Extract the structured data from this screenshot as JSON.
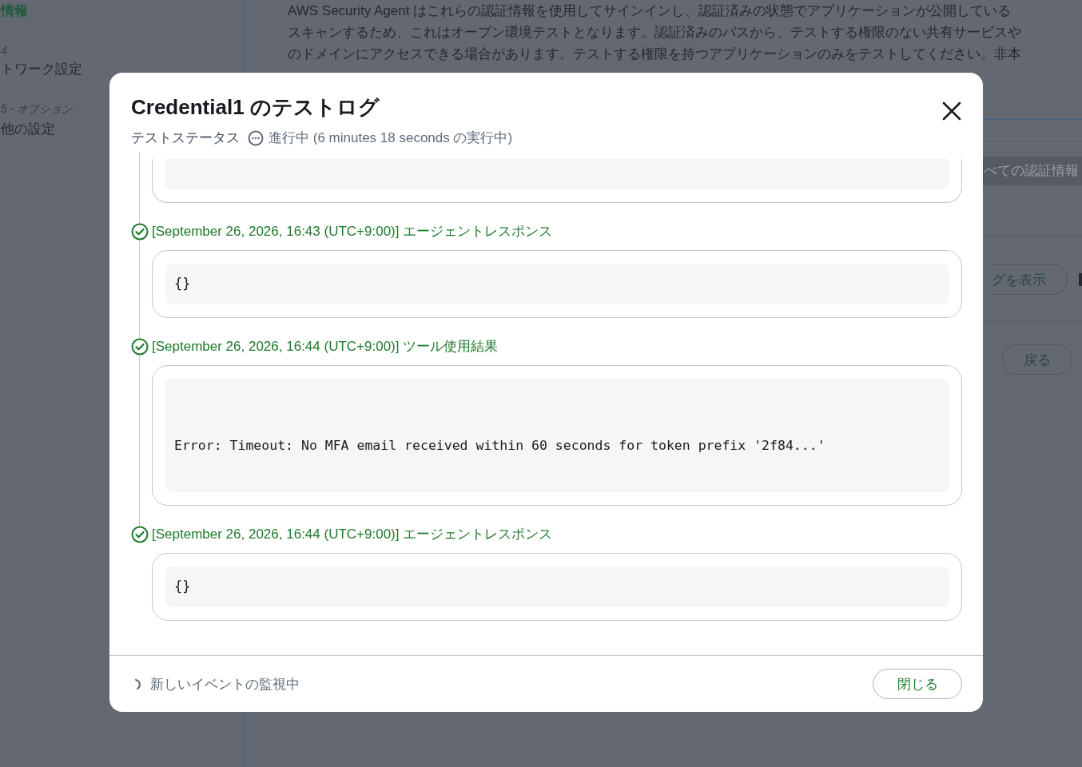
{
  "background": {
    "sidebar": [
      {
        "kind": "link",
        "text": "情報"
      },
      {
        "kind": "step",
        "text": "4"
      },
      {
        "kind": "title",
        "text": "トワーク設定"
      },
      {
        "kind": "step",
        "text": "5 - オプション"
      },
      {
        "kind": "title",
        "text": "他の設定"
      }
    ],
    "notice_lines": [
      "AWS Security Agent はこれらの認証情報を使用してサインインし、認証済みの状態でアプリケーションが公開している",
      "スキャンするため、これはオープン環境テストとなります。認証済みのパスから、テストする権限のない共有サービスや",
      "のドメインにアクセスできる場合があります。テストする権限を持つアプリケーションのみをテストしてください。非本"
    ],
    "filter_placeholder": "べての認証情報",
    "log_button": "グを表示",
    "back_button": "戻る"
  },
  "modal": {
    "title": "Credential1 のテストログ",
    "status_label": "テストステータス",
    "status": "進行中 (6 minutes 18 seconds の実行中)",
    "entries": [
      {
        "kind": "agent_response",
        "header": "[September 26, 2026, 16:43 (UTC+9:00)] エージェントレスポンス",
        "done": true,
        "content": "{}"
      },
      {
        "kind": "tool_result",
        "header": "[September 26, 2026, 16:44 (UTC+9:00)] ツール使用結果",
        "done": true,
        "content": "Error: Timeout: No MFA email received within 60 seconds for token prefix '2f84...'"
      },
      {
        "kind": "agent_response",
        "header": "[September 26, 2026, 16:44 (UTC+9:00)] エージェントレスポンス",
        "done": true,
        "content": "{}"
      }
    ],
    "footer_status": "新しいイベントの監視中",
    "close_button": "閉じる"
  }
}
